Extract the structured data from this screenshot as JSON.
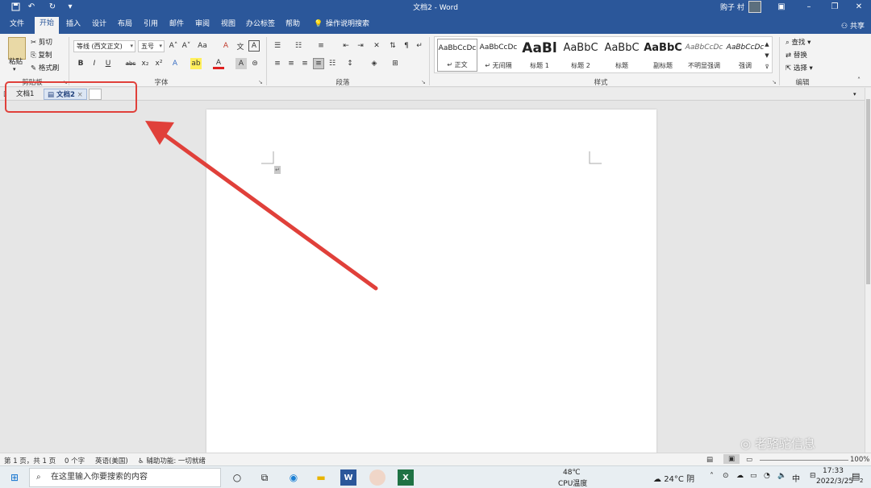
{
  "titlebar": {
    "title": "文档2 - Word",
    "user": "购子 村",
    "save_icon": "save-icon",
    "undo_icon": "undo-icon",
    "redo_icon": "redo-icon",
    "customize_icon": "customize-qat-icon"
  },
  "tabs": [
    "文件",
    "开始",
    "插入",
    "设计",
    "布局",
    "引用",
    "邮件",
    "审阅",
    "视图",
    "办公标签",
    "帮助"
  ],
  "tell_me": "操作说明搜索",
  "share": "共享",
  "clipboard": {
    "paste": "粘贴",
    "cut": "剪切",
    "copy": "复制",
    "format_painter": "格式刷",
    "label": "剪贴板"
  },
  "font": {
    "name": "等线 (西文正文)",
    "size": "五号",
    "label": "字体"
  },
  "paragraph": {
    "label": "段落"
  },
  "styles": {
    "label": "样式",
    "items": [
      {
        "preview": "AaBbCcDc",
        "name": "↵ 正文"
      },
      {
        "preview": "AaBbCcDc",
        "name": "↵ 无间隔"
      },
      {
        "preview": "AaBl",
        "name": "标题 1"
      },
      {
        "preview": "AaBbC",
        "name": "标题 2"
      },
      {
        "preview": "AaBbC",
        "name": "标题"
      },
      {
        "preview": "AaBbC",
        "name": "副标题"
      },
      {
        "preview": "AaBbCcDc",
        "name": "不明显强调"
      },
      {
        "preview": "AaBbCcDc",
        "name": "强调"
      }
    ]
  },
  "editing": {
    "find": "查找",
    "replace": "替换",
    "select": "选择",
    "label": "编辑"
  },
  "doc_tabs": [
    "文档1",
    "文档2"
  ],
  "status": {
    "page": "第 1 页，共 1 页",
    "words": "0 个字",
    "language": "英语(美国)",
    "accessibility": "辅助功能: 一切就绪",
    "zoom": "100%"
  },
  "taskbar": {
    "search_placeholder": "在这里输入你要搜索的内容",
    "cpu_temp": "48℃",
    "cpu_label": "CPU温度",
    "weather": "24°C 阴",
    "ime": "中",
    "time": "17:33",
    "date": "2022/3/25",
    "notif_count": "2"
  },
  "watermark": "老骆驼信息"
}
